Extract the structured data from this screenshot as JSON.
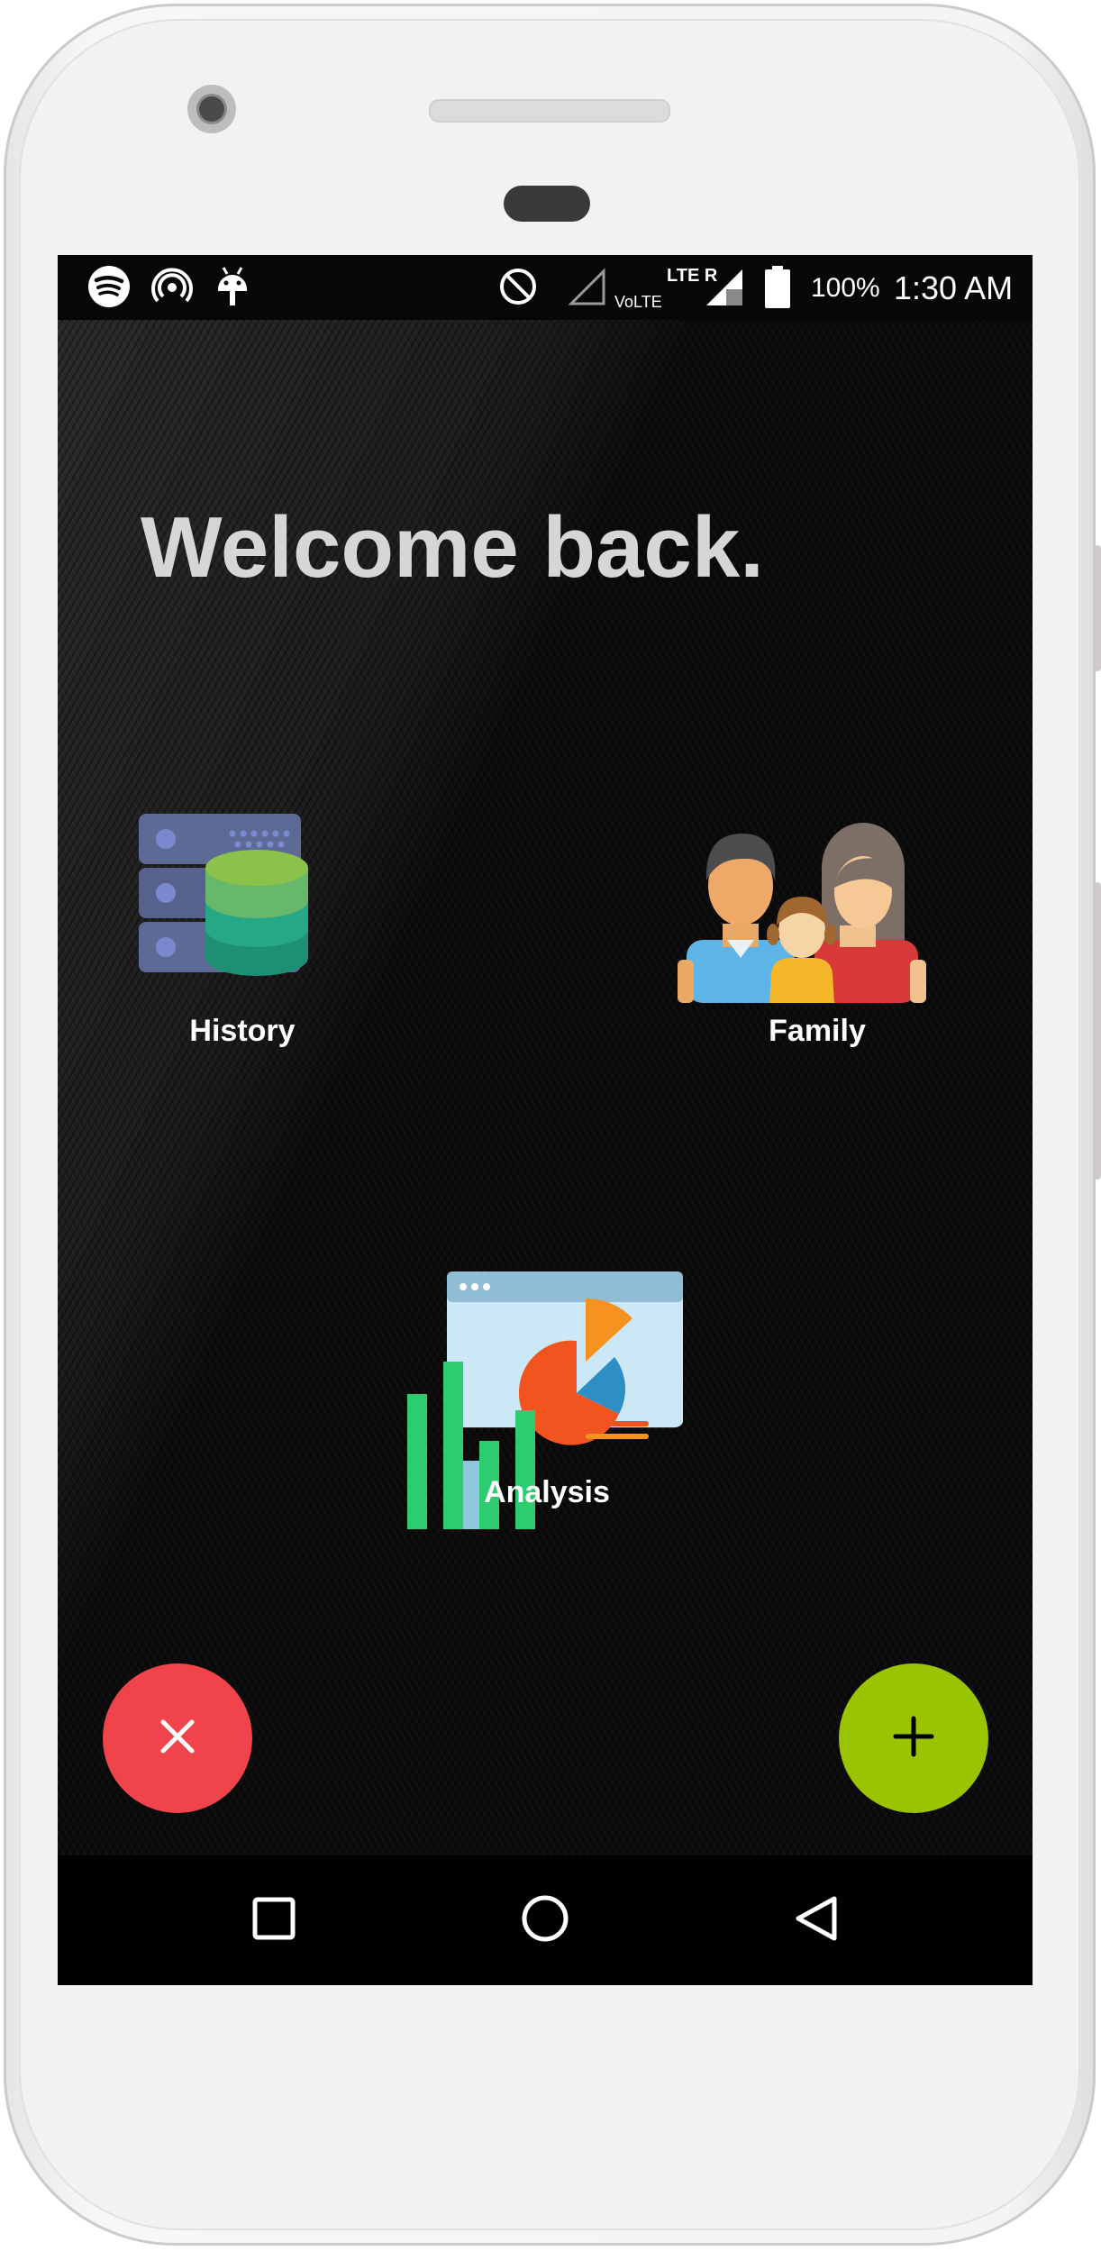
{
  "status_bar": {
    "left_icons": [
      "spotify-icon",
      "hotspot-icon",
      "android-icon"
    ],
    "right_icons": [
      "do-not-disturb-icon",
      "signal-icon",
      "signal-icon",
      "battery-icon"
    ],
    "network_label": "LTE R",
    "volte_label": "VoLTE",
    "battery_percent": "100%",
    "time": "1:30 AM"
  },
  "main": {
    "greeting": "Welcome back.",
    "tiles": [
      {
        "label": "History",
        "icon": "database-server-icon"
      },
      {
        "label": "Family",
        "icon": "family-icon"
      },
      {
        "label": "Analysis",
        "icon": "analytics-chart-icon"
      }
    ]
  },
  "actions": {
    "close_icon": "close-icon",
    "close_color": "#f0434a",
    "add_icon": "plus-icon",
    "add_color": "#9ac400"
  },
  "navigation": {
    "recents_icon": "square-icon",
    "home_icon": "circle-icon",
    "back_icon": "triangle-back-icon"
  }
}
